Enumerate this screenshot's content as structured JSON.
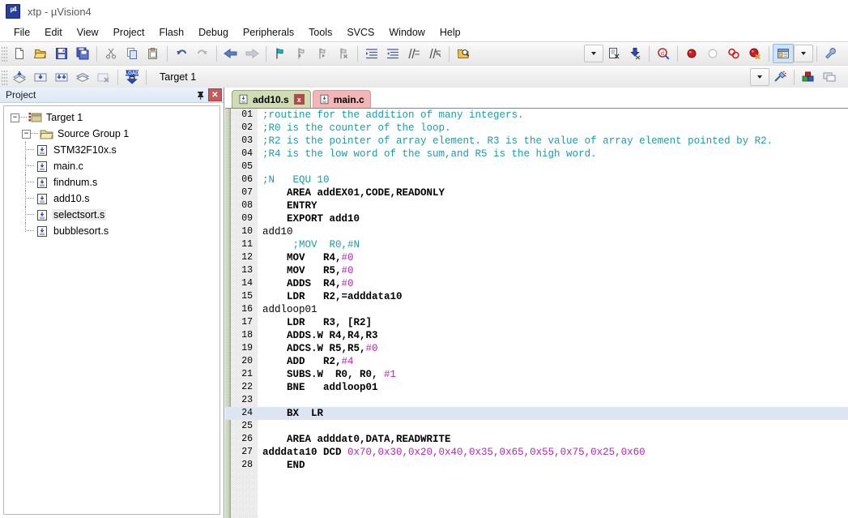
{
  "window": {
    "app_icon": "uvision-logo-icon",
    "logo_text": "µ4",
    "title": "xtp  - µVision4"
  },
  "menubar": {
    "items": [
      {
        "label": "File"
      },
      {
        "label": "Edit"
      },
      {
        "label": "View"
      },
      {
        "label": "Project"
      },
      {
        "label": "Flash"
      },
      {
        "label": "Debug"
      },
      {
        "label": "Peripherals"
      },
      {
        "label": "Tools"
      },
      {
        "label": "SVCS"
      },
      {
        "label": "Window"
      },
      {
        "label": "Help"
      }
    ]
  },
  "toolbar_main": {
    "buttons": [
      {
        "name": "new-file-icon",
        "title": "New"
      },
      {
        "name": "open-file-icon",
        "title": "Open"
      },
      {
        "name": "save-icon",
        "title": "Save"
      },
      {
        "name": "save-all-icon",
        "title": "Save All"
      },
      {
        "name": "cut-icon",
        "title": "Cut"
      },
      {
        "name": "copy-icon",
        "title": "Copy"
      },
      {
        "name": "paste-icon",
        "title": "Paste"
      },
      {
        "name": "undo-icon",
        "title": "Undo"
      },
      {
        "name": "redo-icon",
        "title": "Redo"
      },
      {
        "name": "back-arrow-icon",
        "title": "Back"
      },
      {
        "name": "forward-arrow-icon",
        "title": "Forward"
      },
      {
        "name": "bookmark-toggle-icon",
        "title": "Insert/Remove Bookmark"
      },
      {
        "name": "bookmark-prev-icon",
        "title": "Previous Bookmark"
      },
      {
        "name": "bookmark-next-icon",
        "title": "Next Bookmark"
      },
      {
        "name": "bookmark-clear-icon",
        "title": "Clear All Bookmarks"
      },
      {
        "name": "indent-right-icon",
        "title": "Indent"
      },
      {
        "name": "indent-left-icon",
        "title": "Outdent"
      },
      {
        "name": "comment-icon",
        "title": "Comment"
      },
      {
        "name": "uncomment-icon",
        "title": "Uncomment"
      },
      {
        "name": "open-folder-search-icon",
        "title": "Find in Files"
      }
    ],
    "right_buttons": [
      {
        "name": "dropdown-arrow-icon",
        "title": "Options"
      },
      {
        "name": "configure-icon",
        "title": "Configuration"
      },
      {
        "name": "download-icon",
        "title": "Download"
      },
      {
        "name": "find-icon",
        "title": "Find"
      },
      {
        "name": "breakpoint-icon",
        "title": "Insert/Remove Breakpoint"
      },
      {
        "name": "breakpoint-disable-icon",
        "title": "Enable/Disable Breakpoint"
      },
      {
        "name": "breakpoint-disable-all-icon",
        "title": "Disable All Breakpoints"
      },
      {
        "name": "breakpoint-kill-all-icon",
        "title": "Kill All Breakpoints"
      },
      {
        "name": "window-manager-icon",
        "title": "Manage Windows"
      },
      {
        "name": "wrench-icon",
        "title": "Configure"
      }
    ]
  },
  "toolbar_build": {
    "buttons": [
      {
        "name": "translate-icon",
        "title": "Translate"
      },
      {
        "name": "build-icon",
        "title": "Build"
      },
      {
        "name": "rebuild-icon",
        "title": "Rebuild"
      },
      {
        "name": "batch-build-icon",
        "title": "Batch Build"
      },
      {
        "name": "stop-build-icon",
        "title": "Stop Build"
      },
      {
        "name": "load-icon",
        "title": "Download to Flash",
        "label": "LOAD"
      }
    ],
    "target_select": {
      "value": "Target 1",
      "options": [
        "Target 1"
      ]
    },
    "right_buttons": [
      {
        "name": "target-options-icon",
        "title": "Options for Target"
      },
      {
        "name": "manage-components-icon",
        "title": "Manage Components"
      },
      {
        "name": "multi-project-icon",
        "title": "Multi-Project"
      }
    ]
  },
  "project_panel": {
    "title": "Project",
    "pin_icon": "pin-icon",
    "close_label": "✕",
    "tree": {
      "root": {
        "label": "Target 1",
        "icon": "target-icon",
        "expander": "−"
      },
      "group": {
        "label": "Source Group 1",
        "icon": "folder-icon",
        "expander": "−"
      },
      "files": [
        {
          "label": "STM32F10x.s",
          "icon": "source-file-icon",
          "selected": false
        },
        {
          "label": "main.c",
          "icon": "source-file-icon",
          "selected": false
        },
        {
          "label": "findnum.s",
          "icon": "source-file-icon",
          "selected": false
        },
        {
          "label": "add10.s",
          "icon": "source-file-icon",
          "selected": false
        },
        {
          "label": "selectsort.s",
          "icon": "source-file-icon",
          "selected": true
        },
        {
          "label": "bubblesort.s",
          "icon": "source-file-icon",
          "selected": false
        }
      ]
    }
  },
  "editor": {
    "tabs": [
      {
        "label": "add10.s",
        "icon": "source-file-icon",
        "active": true,
        "closable": true,
        "close_label": "x"
      },
      {
        "label": "main.c",
        "icon": "source-file-icon",
        "active": false,
        "closable": false,
        "close_label": ""
      }
    ],
    "current_line": 24,
    "lines": [
      {
        "n": "01",
        "tokens": [
          {
            "t": ";routine for the addition of many integers.",
            "c": "cm"
          }
        ]
      },
      {
        "n": "02",
        "tokens": [
          {
            "t": ";R0 is the counter of the loop.",
            "c": "cm"
          }
        ]
      },
      {
        "n": "03",
        "tokens": [
          {
            "t": ";R2 is the pointer of array element. R3 is the value of array element pointed by R2.",
            "c": "cm"
          }
        ]
      },
      {
        "n": "04",
        "tokens": [
          {
            "t": ";R4 is the low word of the sum,and R5 is the high word.",
            "c": "cm"
          }
        ]
      },
      {
        "n": "05",
        "tokens": [
          {
            "t": "",
            "c": "pl"
          }
        ]
      },
      {
        "n": "06",
        "tokens": [
          {
            "t": ";N   EQU 10",
            "c": "cm"
          }
        ]
      },
      {
        "n": "07",
        "tokens": [
          {
            "t": "    AREA addEX01,CODE,READONLY",
            "c": "kw"
          }
        ]
      },
      {
        "n": "08",
        "tokens": [
          {
            "t": "    ENTRY",
            "c": "kw"
          }
        ]
      },
      {
        "n": "09",
        "tokens": [
          {
            "t": "    EXPORT add10",
            "c": "kw"
          }
        ]
      },
      {
        "n": "10",
        "tokens": [
          {
            "t": "add10",
            "c": "pl"
          }
        ]
      },
      {
        "n": "11",
        "tokens": [
          {
            "t": "     ;MOV  R0,#N",
            "c": "cm"
          }
        ]
      },
      {
        "n": "12",
        "tokens": [
          {
            "t": "    MOV   R4,",
            "c": "kw"
          },
          {
            "t": "#0",
            "c": "num"
          }
        ]
      },
      {
        "n": "13",
        "tokens": [
          {
            "t": "    MOV   R5,",
            "c": "kw"
          },
          {
            "t": "#0",
            "c": "num"
          }
        ]
      },
      {
        "n": "14",
        "tokens": [
          {
            "t": "    ADDS  R4,",
            "c": "kw"
          },
          {
            "t": "#0",
            "c": "num"
          }
        ]
      },
      {
        "n": "15",
        "tokens": [
          {
            "t": "    LDR   R2,=adddata10",
            "c": "kw"
          }
        ]
      },
      {
        "n": "16",
        "tokens": [
          {
            "t": "addloop01",
            "c": "pl"
          }
        ]
      },
      {
        "n": "17",
        "tokens": [
          {
            "t": "    LDR   R3, [R2]",
            "c": "kw"
          }
        ]
      },
      {
        "n": "18",
        "tokens": [
          {
            "t": "    ADDS.W R4,R4,R3",
            "c": "kw"
          }
        ]
      },
      {
        "n": "19",
        "tokens": [
          {
            "t": "    ADCS.W R5,R5,",
            "c": "kw"
          },
          {
            "t": "#0",
            "c": "num"
          }
        ]
      },
      {
        "n": "20",
        "tokens": [
          {
            "t": "    ADD   R2,",
            "c": "kw"
          },
          {
            "t": "#4",
            "c": "num"
          }
        ]
      },
      {
        "n": "21",
        "tokens": [
          {
            "t": "    SUBS.W  R0, R0, ",
            "c": "kw"
          },
          {
            "t": "#1",
            "c": "num"
          }
        ]
      },
      {
        "n": "22",
        "tokens": [
          {
            "t": "    BNE   addloop01",
            "c": "kw"
          }
        ]
      },
      {
        "n": "23",
        "tokens": [
          {
            "t": "",
            "c": "pl"
          }
        ]
      },
      {
        "n": "24",
        "tokens": [
          {
            "t": "    BX  LR",
            "c": "kw"
          }
        ],
        "highlight": true
      },
      {
        "n": "25",
        "tokens": [
          {
            "t": "",
            "c": "pl"
          }
        ]
      },
      {
        "n": "26",
        "tokens": [
          {
            "t": "    AREA adddat0,DATA,READWRITE",
            "c": "kw"
          }
        ]
      },
      {
        "n": "27",
        "tokens": [
          {
            "t": "adddata10 DCD ",
            "c": "kw"
          },
          {
            "t": "0x70,0x30,0x20,0x40,0x35,0x65,0x55,0x75,0x25,0x60",
            "c": "num"
          }
        ]
      },
      {
        "n": "28",
        "tokens": [
          {
            "t": "    END",
            "c": "kw"
          }
        ]
      }
    ]
  },
  "colors": {
    "comment": "#1f9aa8",
    "number": "#b327b3",
    "keyword": "#000000",
    "active_tab_bg": "#cfdcb4",
    "inactive_tab_bg": "#f2b6b6",
    "current_line_bg": "#dde5f2",
    "close_btn_bg": "#c55a5a"
  }
}
